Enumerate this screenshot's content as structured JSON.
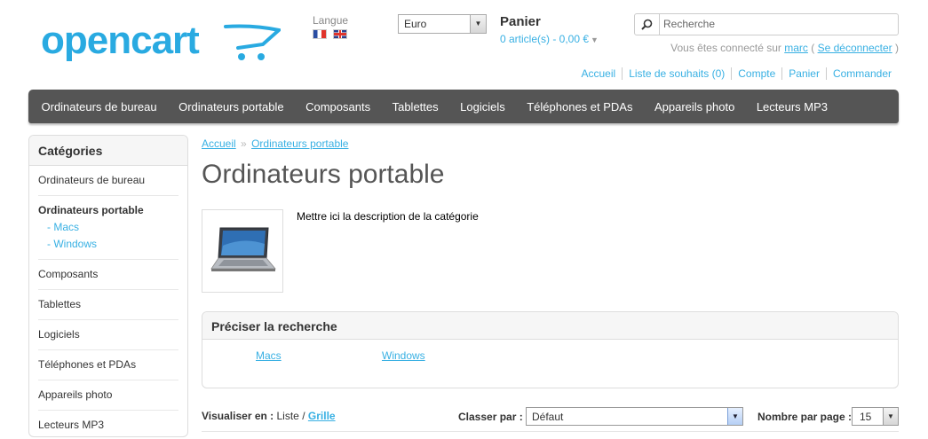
{
  "header": {
    "logo_text": "opencart",
    "language_label": "Langue",
    "languages": [
      "Français",
      "English"
    ],
    "currency": "Euro",
    "cart_title": "Panier",
    "cart_summary": "0 article(s) - 0,00 €",
    "search_placeholder": "Recherche",
    "welcome_prefix": "Vous êtes connecté sur",
    "welcome_user": "marc",
    "welcome_open": "(",
    "logout_label": "Se déconnecter",
    "welcome_close": ")",
    "top_links": [
      "Accueil",
      "Liste de souhaits (0)",
      "Compte",
      "Panier",
      "Commander"
    ]
  },
  "menu": {
    "items": [
      "Ordinateurs de bureau",
      "Ordinateurs portable",
      "Composants",
      "Tablettes",
      "Logiciels",
      "Téléphones et PDAs",
      "Appareils photo",
      "Lecteurs MP3"
    ]
  },
  "sidebar": {
    "title": "Catégories",
    "items": [
      {
        "label": "Ordinateurs de bureau"
      },
      {
        "label": "Ordinateurs portable",
        "children": [
          "- Macs",
          "- Windows"
        ]
      },
      {
        "label": "Composants"
      },
      {
        "label": "Tablettes"
      },
      {
        "label": "Logiciels"
      },
      {
        "label": "Téléphones et PDAs"
      },
      {
        "label": "Appareils photo"
      },
      {
        "label": "Lecteurs MP3"
      }
    ]
  },
  "content": {
    "breadcrumb": [
      "Accueil",
      "Ordinateurs portable"
    ],
    "breadcrumb_sep": "»",
    "title": "Ordinateurs portable",
    "description": "Mettre ici la description de la catégorie",
    "refine_title": "Préciser la recherche",
    "refine_links": [
      "Macs",
      "Windows"
    ],
    "display_label": "Visualiser en :",
    "display_list": "Liste",
    "display_sep": "/",
    "display_grid": "Grille",
    "sort_label": "Classer par :",
    "sort_value": "Défaut",
    "limit_label": "Nombre par page :",
    "limit_value": "15"
  },
  "colors": {
    "accent": "#38b0e3",
    "menu_bg": "#555555",
    "logo": "#29aae1"
  }
}
